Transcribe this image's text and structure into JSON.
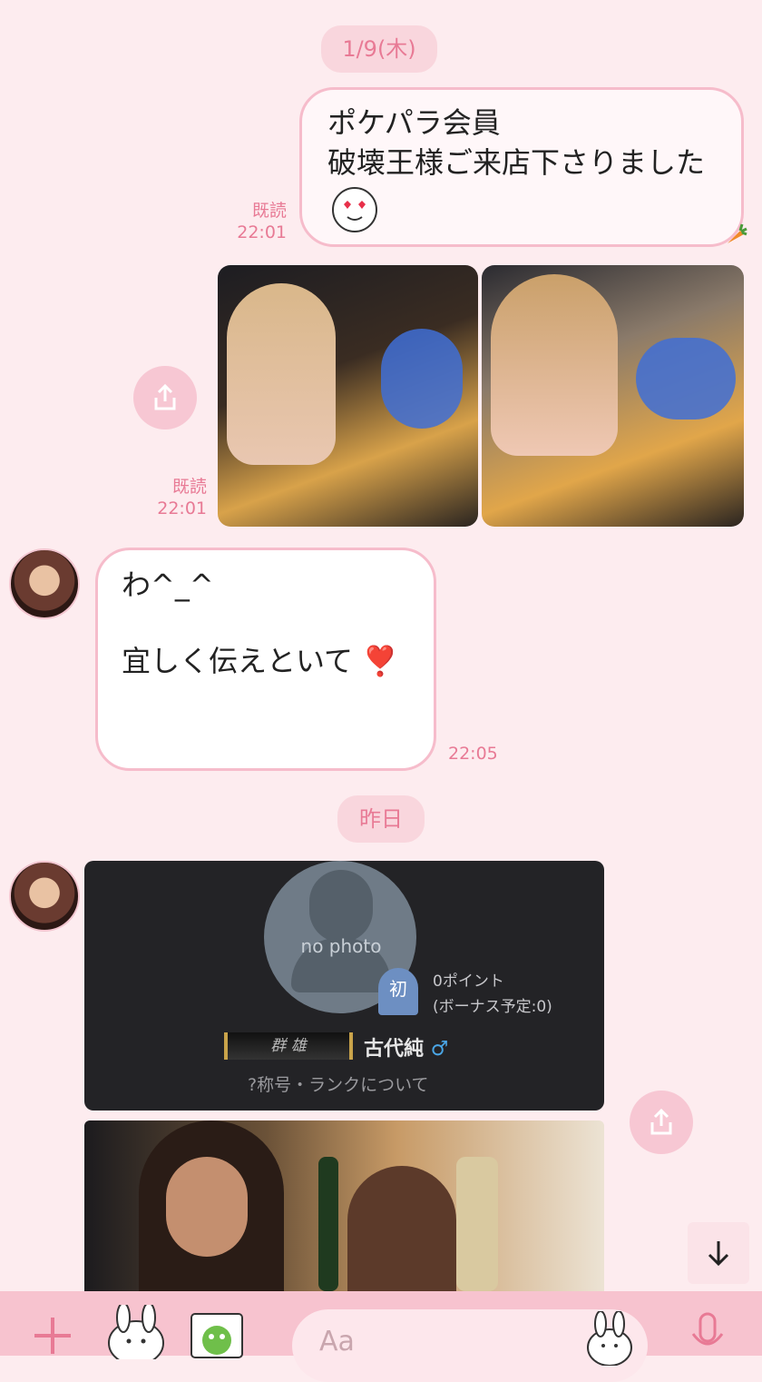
{
  "dates": {
    "first": "1/9(木)",
    "second": "昨日"
  },
  "messages": [
    {
      "direction": "out",
      "lines": "ポケパラ会員\n破壊王様ご来店下さりました",
      "emoji": "smiling-face-with-heart-eyes",
      "read": "既読",
      "time": "22:01"
    },
    {
      "direction": "out",
      "type": "photos",
      "read": "既読",
      "time": "22:01"
    },
    {
      "direction": "in",
      "line1": "わ^_^",
      "line2": "宜しく伝えといて",
      "emoji": "❣️",
      "time": "22:05"
    }
  ],
  "profile_card": {
    "no_photo": "no photo",
    "badge": "初",
    "points": "0ポイント",
    "bonus": "(ボーナス予定:0)",
    "title_plate": "群 雄",
    "name": "古代純",
    "gender_symbol": "♂",
    "rank_link": "?称号・ランクについて"
  },
  "toolbar": {
    "input_placeholder": "Aa"
  },
  "colors": {
    "background": "#fdecef",
    "accent": "#e87a95",
    "bubble_border": "#f6bccb",
    "toolbar": "#f7c3cf"
  }
}
